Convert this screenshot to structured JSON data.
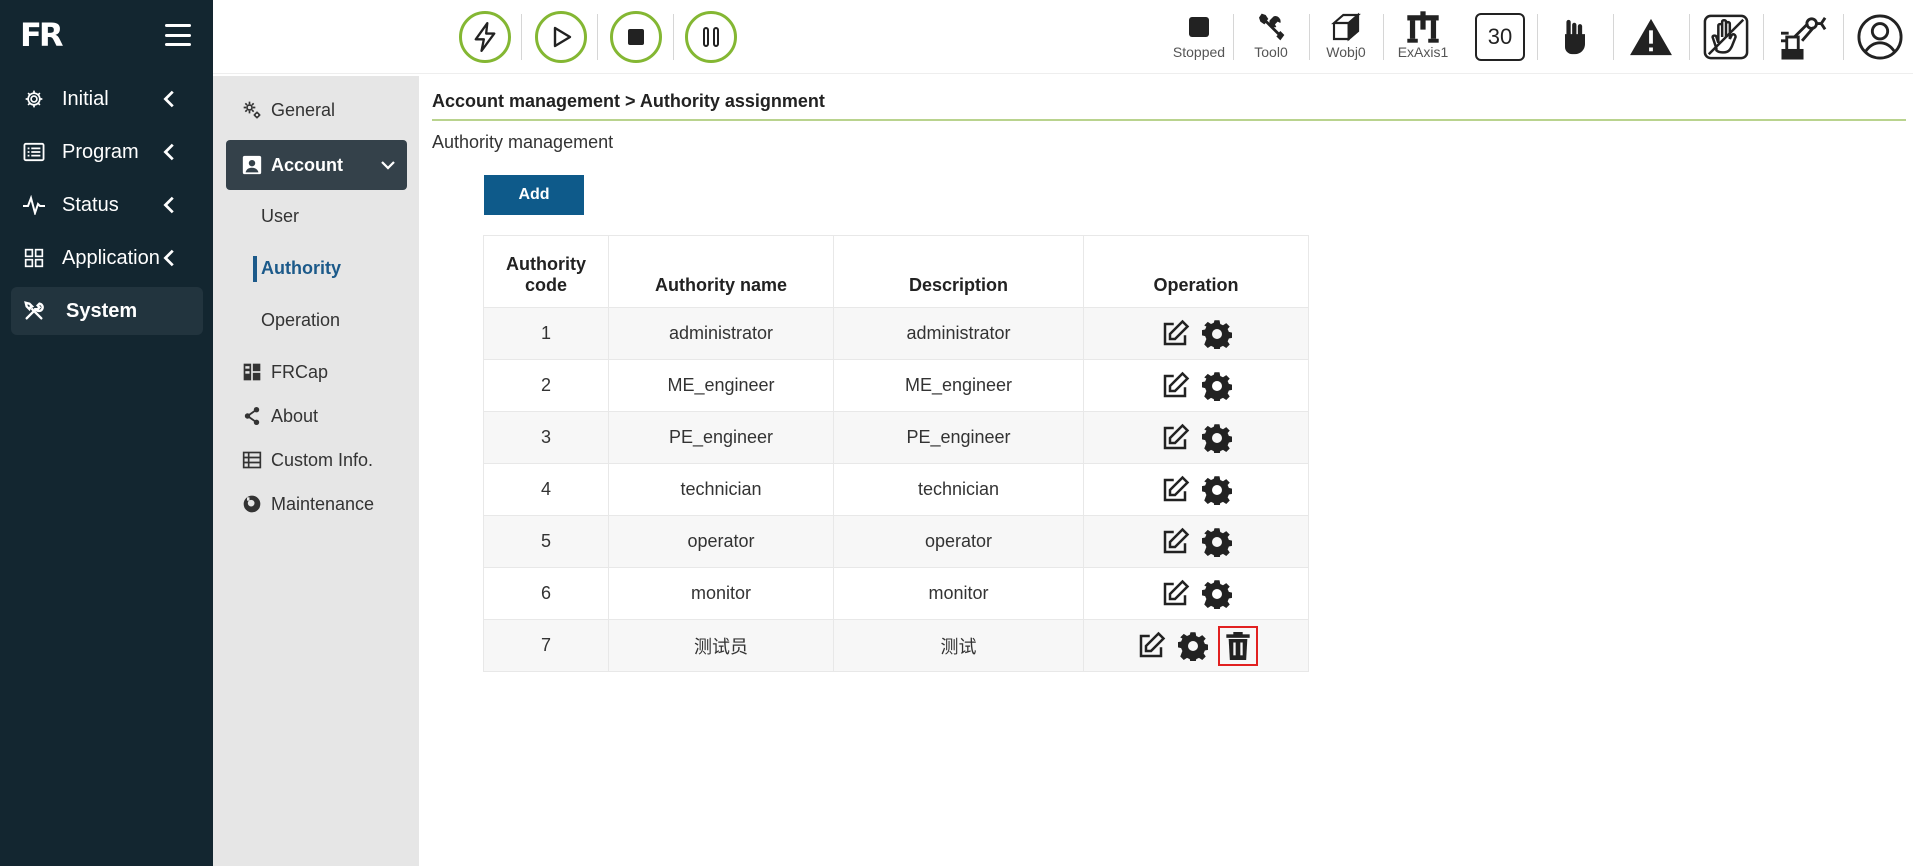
{
  "app": {
    "logo": "FR"
  },
  "leftnav": {
    "items": [
      {
        "label": "Initial",
        "icon": "gear-icon"
      },
      {
        "label": "Program",
        "icon": "list-icon"
      },
      {
        "label": "Status",
        "icon": "pulse-icon"
      },
      {
        "label": "Application",
        "icon": "grid-icon"
      },
      {
        "label": "System",
        "icon": "tools-icon",
        "active": true
      }
    ]
  },
  "subnav": {
    "general": "General",
    "account": "Account",
    "children": [
      "User",
      "Authority",
      "Operation"
    ],
    "frcap": "FRCap",
    "about": "About",
    "custom_info": "Custom Info.",
    "maintenance": "Maintenance"
  },
  "topbar": {
    "status_stopped": "Stopped",
    "tool": "Tool0",
    "wobj": "Wobj0",
    "exaxis": "ExAxis1",
    "speed": "30"
  },
  "main": {
    "breadcrumb": "Account management > Authority assignment",
    "section_title": "Authority management",
    "add_label": "Add",
    "table": {
      "headers": [
        "Authority code",
        "Authority name",
        "Description",
        "Operation"
      ],
      "rows": [
        {
          "code": "1",
          "name": "administrator",
          "description": "administrator"
        },
        {
          "code": "2",
          "name": "ME_engineer",
          "description": "ME_engineer"
        },
        {
          "code": "3",
          "name": "PE_engineer",
          "description": "PE_engineer"
        },
        {
          "code": "4",
          "name": "technician",
          "description": "technician"
        },
        {
          "code": "5",
          "name": "operator",
          "description": "operator"
        },
        {
          "code": "6",
          "name": "monitor",
          "description": "monitor"
        },
        {
          "code": "7",
          "name": "测试员",
          "description": "测试"
        }
      ]
    }
  },
  "colors": {
    "sidebar_bg": "#132630",
    "subnav_bg": "#e6e6e6",
    "accent_green": "#84b733",
    "primary_blue": "#0e5a8a",
    "highlight_red": "#e12020"
  }
}
